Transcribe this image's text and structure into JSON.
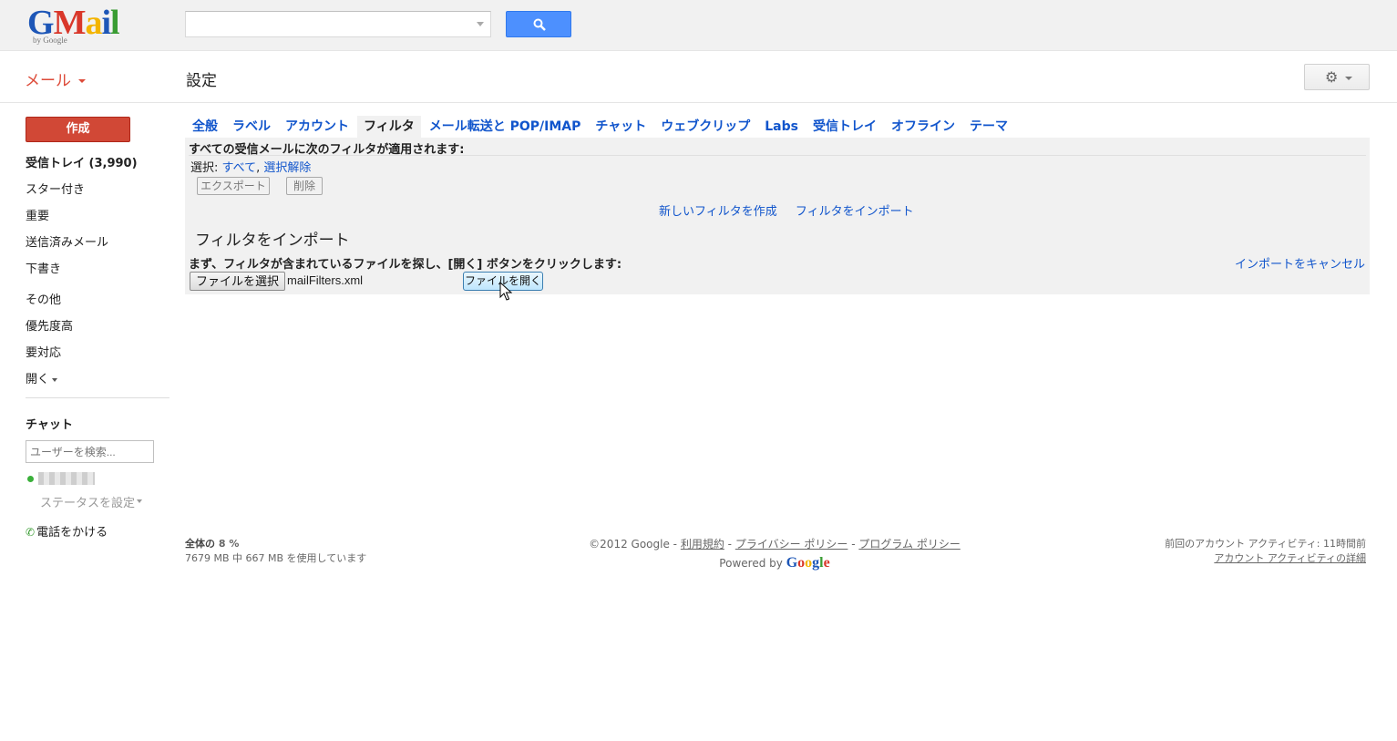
{
  "header": {
    "logo_text": "Gmail",
    "logo_sub": "by Google",
    "search_value": ""
  },
  "subbar": {
    "mail_menu_label": "メール",
    "page_title": "設定"
  },
  "sidebar": {
    "compose_label": "作成",
    "items": [
      {
        "label": "受信トレイ (3,990)"
      },
      {
        "label": "スター付き"
      },
      {
        "label": "重要"
      },
      {
        "label": "送信済みメール"
      },
      {
        "label": "下書き"
      },
      {
        "label": "その他"
      },
      {
        "label": "優先度高"
      },
      {
        "label": "要対応"
      },
      {
        "label": "開く"
      }
    ],
    "chat_title": "チャット",
    "chat_search_placeholder": "ユーザーを検索...",
    "status_label": "ステータスを設定",
    "call_label": "電話をかける"
  },
  "tabs": [
    {
      "label": "全般"
    },
    {
      "label": "ラベル"
    },
    {
      "label": "アカウント"
    },
    {
      "label": "フィルタ"
    },
    {
      "label": "メール転送と POP/IMAP"
    },
    {
      "label": "チャット"
    },
    {
      "label": "ウェブクリップ"
    },
    {
      "label": "Labs"
    },
    {
      "label": "受信トレイ"
    },
    {
      "label": "オフライン"
    },
    {
      "label": "テーマ"
    }
  ],
  "filters": {
    "heading": "すべての受信メールに次のフィルタが適用されます:",
    "select_label": "選択:",
    "select_all": "すべて",
    "select_none": "選択解除",
    "export_label": "エクスポート",
    "delete_label": "削除",
    "create_link": "新しいフィルタを作成",
    "import_link": "フィルタをインポート"
  },
  "import": {
    "title": "フィルタをインポート",
    "instruction": "まず、フィルタが含まれているファイルを探し、[開く] ボタンをクリックします:",
    "cancel_label": "インポートをキャンセル",
    "choose_file_label": "ファイルを選択",
    "file_name": "mailFilters.xml",
    "open_file_label": "ファイルを開く"
  },
  "footer": {
    "quota_label": "全体の",
    "quota_percent": "8 %",
    "usage": "7679 MB 中 667 MB を使用しています",
    "copyright": "©2012 Google -",
    "terms": "利用規約",
    "privacy": "プライバシー ポリシー",
    "program": "プログラム ポリシー",
    "powered_by": "Powered by",
    "google": "Google",
    "last_activity": "前回のアカウント アクティビティ: 11時間前",
    "activity_details": "アカウント アクティビティの詳細"
  }
}
